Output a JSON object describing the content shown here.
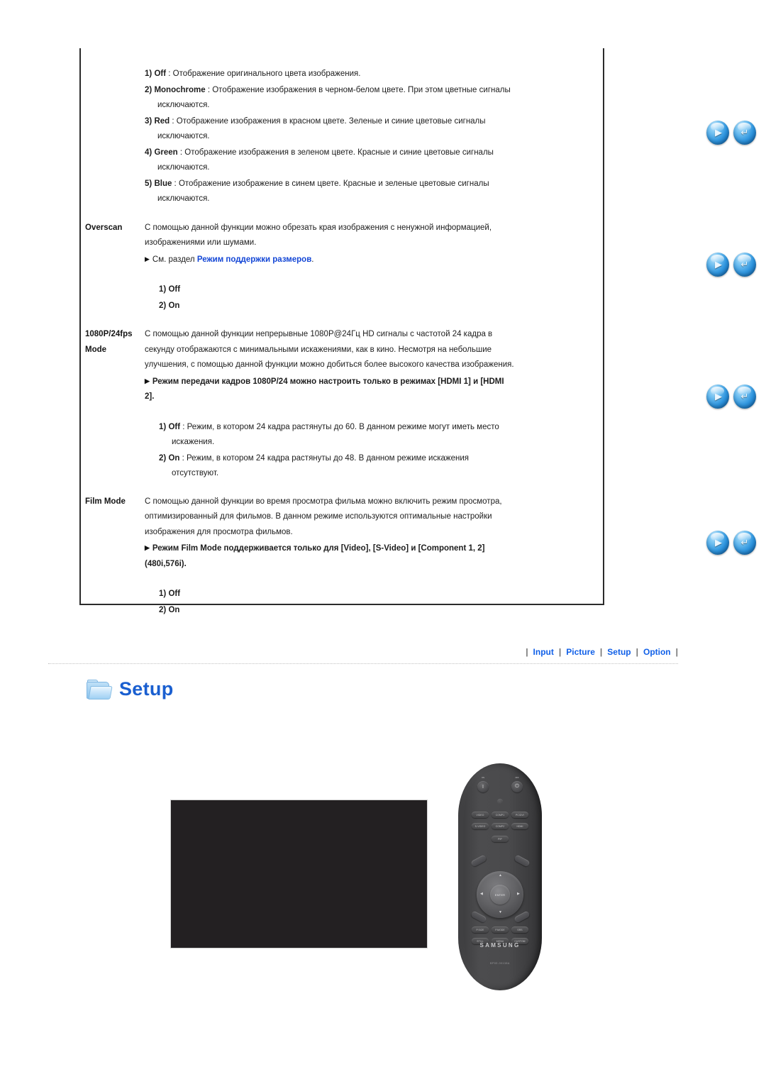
{
  "page": {
    "color_mode_options": [
      {
        "n": "1)",
        "term": "Off",
        "sep": " : ",
        "text": "Отображение оригинального цвета изображения."
      },
      {
        "n": "2)",
        "term": "Monochrome",
        "sep": " : ",
        "text": "Отображение изображения в черном-белом цвете. При этом цветные сигналы исключаются."
      },
      {
        "n": "3)",
        "term": "Red",
        "sep": " : ",
        "text": "Отображение изображения в красном цвете. Зеленые и синие цветовые сигналы исключаются."
      },
      {
        "n": "4)",
        "term": "Green",
        "sep": " : ",
        "text": "Отображение изображения в зеленом цвете. Красные и синие цветовые сигналы исключаются."
      },
      {
        "n": "5)",
        "term": "Blue",
        "sep": " : ",
        "text": "Отображение изображение в синем цвете. Красные и зеленые цветовые сигналы исключаются."
      }
    ],
    "overscan": {
      "label": "Overscan",
      "paragraph": "С помощью данной функции можно обрезать края изображения с ненужной информацией, изображениями или шумами.",
      "note_prefix": "См. раздел ",
      "note_link": "Режим поддержки размеров",
      "note_suffix": ".",
      "options": [
        {
          "n": "1)",
          "term": "Off"
        },
        {
          "n": "2)",
          "term": "On"
        }
      ]
    },
    "fps_mode": {
      "label_line1": "1080P/24fps",
      "label_line2": "Mode",
      "paragraph": "С помощью данной функции непрерывные 1080P@24Гц HD сигналы с частотой 24 кадра в секунду отображаются с минимальными искажениями, как в кино. Несмотря на небольшие улучшения, с помощью данной функции можно добиться более высокого качества изображения.",
      "note": "Режим передачи кадров 1080P/24 можно настроить только в режимах [HDMI 1] и [HDMI 2].",
      "options": [
        {
          "n": "1)",
          "term": "Off",
          "sep": " : ",
          "text": "Режим, в котором 24 кадра растянуты до 60. В данном режиме могут иметь место искажения."
        },
        {
          "n": "2)",
          "term": "On",
          "sep": " : ",
          "text": "Режим, в котором 24 кадра растянуты до 48. В данном режиме искажения отсутствуют."
        }
      ]
    },
    "film_mode": {
      "label": "Film Mode",
      "paragraph": "С помощью данной функции во время просмотра фильма можно включить режим просмотра, оптимизированный для фильмов. В данном режиме используются оптимальные настройки изображения для просмотра фильмов.",
      "note": "Режим Film Mode поддерживается только для [Video], [S-Video] и [Component 1, 2](480i,576i).",
      "options": [
        {
          "n": "1)",
          "term": "Off"
        },
        {
          "n": "2)",
          "term": "On"
        }
      ]
    }
  },
  "nav": {
    "separator": "|",
    "items": [
      {
        "label": "Input"
      },
      {
        "label": "Picture"
      },
      {
        "label": "Setup"
      },
      {
        "label": "Option"
      }
    ]
  },
  "section": {
    "title": "Setup",
    "icon": "folder-icon"
  },
  "orb_buttons": {
    "next_glyph": "▶",
    "return_glyph": "↵"
  },
  "remote": {
    "brand": "SAMSUNG",
    "model": "BP59-00138A",
    "power": {
      "on_label": "ON",
      "off_label": "OFF",
      "on_glyph": "I",
      "off_glyph": "⏻"
    },
    "source_glyph": "⊙",
    "input_keys": [
      "VIDEO",
      "COMP1",
      "PC/DVI",
      "S-VIDEO",
      "COMP2",
      "HDMI",
      "PIP"
    ],
    "dpad": {
      "enter": "ENTER",
      "up": "▲",
      "down": "▼",
      "left": "◀",
      "right": "▶"
    },
    "lower_keys": [
      "P.SIZE",
      "P.MODE",
      "SRS",
      "STILL",
      "MENU",
      "CUSTOM"
    ]
  },
  "colors": {
    "link_blue": "#1160e8",
    "note_link_blue": "#1447d6",
    "section_title_blue": "#1a5fd0",
    "screen_black": "#232022",
    "border": "#2b2b2b"
  }
}
